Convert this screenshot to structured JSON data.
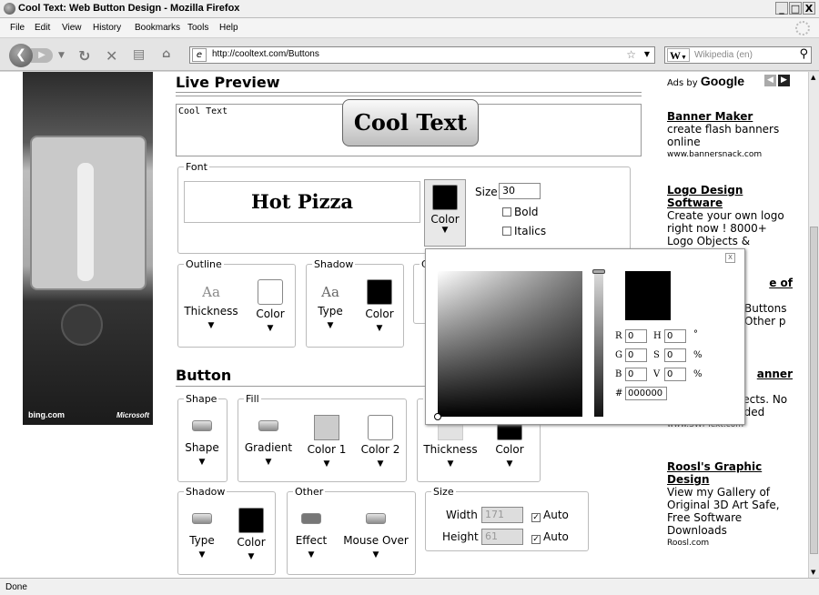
{
  "window": {
    "title": "Cool Text: Web Button Design - Mozilla Firefox",
    "btn_min": "_",
    "btn_max": "□",
    "btn_close": "X"
  },
  "menu": {
    "items": [
      "File",
      "Edit",
      "View",
      "History",
      "Bookmarks",
      "Tools",
      "Help"
    ]
  },
  "nav": {
    "url": "http://cooltext.com/Buttons",
    "search_engine": "W",
    "search_placeholder": "Wikipedia (en)"
  },
  "status": {
    "text": "Done"
  },
  "bing": {
    "left": "bing.com",
    "right": "Microsoft"
  },
  "live_preview": {
    "title": "Live Preview",
    "text": "Cool Text",
    "button_text": "Cool Text"
  },
  "font": {
    "legend": "Font",
    "preview": "Hot Pizza",
    "color_label": "Color",
    "size_label": "Size",
    "size_value": "30",
    "bold_label": "Bold",
    "italics_label": "Italics"
  },
  "outline": {
    "legend": "Outline",
    "sample": "Aa",
    "thickness_label": "Thickness",
    "color_label": "Color"
  },
  "shadow_text": {
    "legend": "Shadow",
    "sample": "Aa",
    "type_label": "Type",
    "color_label": "Color"
  },
  "hidden_fieldset": {
    "legend": "C"
  },
  "button_section": {
    "title": "Button"
  },
  "shape": {
    "legend": "Shape",
    "label": "Shape"
  },
  "fill": {
    "legend": "Fill",
    "gradient_label": "Gradient",
    "color1_label": "Color 1",
    "color2_label": "Color 2"
  },
  "border": {
    "legend": "C",
    "thickness_label": "Thickness",
    "color_label": "Color"
  },
  "btn_shadow": {
    "legend": "Shadow",
    "type_label": "Type",
    "color_label": "Color"
  },
  "other": {
    "legend": "Other",
    "effect_label": "Effect",
    "mouseover_label": "Mouse Over"
  },
  "size": {
    "legend": "Size",
    "width_label": "Width",
    "width_value": "171",
    "height_label": "Height",
    "height_value": "61",
    "auto_label": "Auto"
  },
  "picker": {
    "close": "X",
    "r_label": "R",
    "r_value": "0",
    "g_label": "G",
    "g_value": "0",
    "b_label": "B",
    "b_value": "0",
    "h_label": "H",
    "h_value": "0",
    "s_label": "S",
    "s_value": "0",
    "v_label": "V",
    "v_value": "0",
    "deg": "°",
    "pct": "%",
    "hash": "#",
    "hex_value": "000000",
    "color": "#000000"
  },
  "ads": {
    "header_ads_by": "Ads by",
    "header_google": "Google",
    "items": [
      {
        "title": "Banner Maker",
        "body": "create flash banners online",
        "url": "www.bannersnack.com"
      },
      {
        "title": "Logo Design Software",
        "body": "Create your own logo right now ! 8000+ Logo Objects &",
        "url": ""
      },
      {
        "title": "e of",
        "body": "Buttons Other p",
        "url": ""
      },
      {
        "title": "anner",
        "body": "nner in 0+ effects. No Flash skill needed",
        "url": "www.SWFText.com"
      },
      {
        "title": "Roosl's Graphic Design",
        "body": "View my Gallery of Original 3D Art Safe, Free Software Downloads",
        "url": "Roosl.com"
      }
    ]
  }
}
